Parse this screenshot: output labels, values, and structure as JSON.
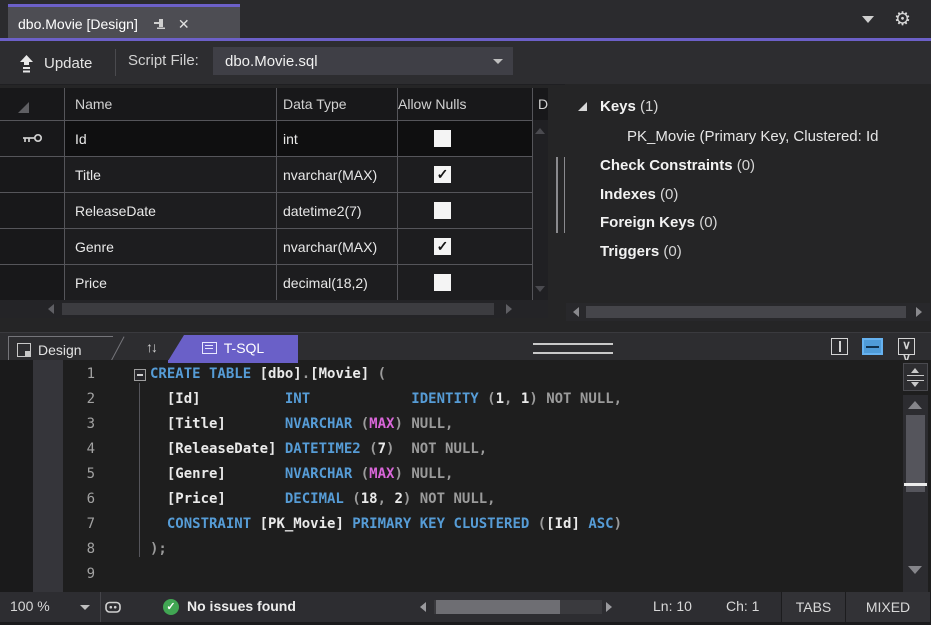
{
  "doc_tab": {
    "title": "dbo.Movie [Design]"
  },
  "toolbar": {
    "update_label": "Update",
    "script_file_label": "Script File:",
    "script_file_value": "dbo.Movie.sql"
  },
  "grid": {
    "columns": [
      "Name",
      "Data Type",
      "Allow Nulls",
      "D"
    ],
    "rows": [
      {
        "name": "Id",
        "data_type": "int",
        "allow_nulls": false,
        "is_key": true,
        "selected": true
      },
      {
        "name": "Title",
        "data_type": "nvarchar(MAX)",
        "allow_nulls": true,
        "is_key": false,
        "selected": false
      },
      {
        "name": "ReleaseDate",
        "data_type": "datetime2(7)",
        "allow_nulls": false,
        "is_key": false,
        "selected": false
      },
      {
        "name": "Genre",
        "data_type": "nvarchar(MAX)",
        "allow_nulls": true,
        "is_key": false,
        "selected": false
      },
      {
        "name": "Price",
        "data_type": "decimal(18,2)",
        "allow_nulls": false,
        "is_key": false,
        "selected": false
      }
    ]
  },
  "context_panel": {
    "rows": [
      {
        "type": "group",
        "label": "Keys",
        "count": "(1)",
        "expanded": true
      },
      {
        "type": "item",
        "name": "PK_Movie",
        "detail": "   (Primary Key, Clustered: Id"
      },
      {
        "type": "group",
        "label": "Check Constraints",
        "count": "(0)",
        "expanded": false
      },
      {
        "type": "group",
        "label": "Indexes",
        "count": "(0)",
        "expanded": false
      },
      {
        "type": "group",
        "label": "Foreign Keys",
        "count": "(0)",
        "expanded": false
      },
      {
        "type": "group",
        "label": "Triggers",
        "count": "(0)",
        "expanded": false
      }
    ]
  },
  "pane_tabs": {
    "design_label": "Design",
    "tsql_label": "T-SQL"
  },
  "editor": {
    "lines": [
      {
        "n": "1",
        "toks": [
          {
            "c": "k",
            "t": "CREATE TABLE"
          },
          {
            "c": "i",
            "t": " [dbo]"
          },
          {
            "c": "g",
            "t": "."
          },
          {
            "c": "i",
            "t": "[Movie]"
          },
          {
            "c": "g",
            "t": " ("
          }
        ]
      },
      {
        "n": "2",
        "toks": [
          {
            "c": "i",
            "t": "  [Id]          "
          },
          {
            "c": "k",
            "t": "INT            "
          },
          {
            "c": "k",
            "t": "IDENTITY"
          },
          {
            "c": "g",
            "t": " ("
          },
          {
            "c": "n",
            "t": "1"
          },
          {
            "c": "g",
            "t": ", "
          },
          {
            "c": "n",
            "t": "1"
          },
          {
            "c": "g",
            "t": ") "
          },
          {
            "c": "g",
            "t": "NOT NULL,"
          }
        ]
      },
      {
        "n": "3",
        "toks": [
          {
            "c": "i",
            "t": "  [Title]       "
          },
          {
            "c": "k",
            "t": "NVARCHAR"
          },
          {
            "c": "g",
            "t": " ("
          },
          {
            "c": "m",
            "t": "MAX"
          },
          {
            "c": "g",
            "t": ") "
          },
          {
            "c": "g",
            "t": "NULL,"
          }
        ]
      },
      {
        "n": "4",
        "toks": [
          {
            "c": "i",
            "t": "  [ReleaseDate] "
          },
          {
            "c": "k",
            "t": "DATETIME2"
          },
          {
            "c": "g",
            "t": " ("
          },
          {
            "c": "n",
            "t": "7"
          },
          {
            "c": "g",
            "t": ")  "
          },
          {
            "c": "g",
            "t": "NOT NULL,"
          }
        ]
      },
      {
        "n": "5",
        "toks": [
          {
            "c": "i",
            "t": "  [Genre]       "
          },
          {
            "c": "k",
            "t": "NVARCHAR"
          },
          {
            "c": "g",
            "t": " ("
          },
          {
            "c": "m",
            "t": "MAX"
          },
          {
            "c": "g",
            "t": ") "
          },
          {
            "c": "g",
            "t": "NULL,"
          }
        ]
      },
      {
        "n": "6",
        "toks": [
          {
            "c": "i",
            "t": "  [Price]       "
          },
          {
            "c": "k",
            "t": "DECIMAL"
          },
          {
            "c": "g",
            "t": " ("
          },
          {
            "c": "n",
            "t": "18"
          },
          {
            "c": "g",
            "t": ", "
          },
          {
            "c": "n",
            "t": "2"
          },
          {
            "c": "g",
            "t": ") "
          },
          {
            "c": "g",
            "t": "NOT NULL,"
          }
        ]
      },
      {
        "n": "7",
        "toks": [
          {
            "c": "k",
            "t": "  CONSTRAINT"
          },
          {
            "c": "i",
            "t": " [PK_Movie]"
          },
          {
            "c": "k",
            "t": " PRIMARY KEY CLUSTERED"
          },
          {
            "c": "g",
            "t": " ("
          },
          {
            "c": "i",
            "t": "[Id]"
          },
          {
            "c": "k",
            "t": " ASC"
          },
          {
            "c": "g",
            "t": ")"
          }
        ]
      },
      {
        "n": "8",
        "toks": [
          {
            "c": "g",
            "t": ");"
          }
        ]
      },
      {
        "n": "9",
        "toks": []
      }
    ]
  },
  "status_bar": {
    "zoom": "100 %",
    "message": "No issues found",
    "ln": "Ln: 10",
    "ch": "Ch: 1",
    "tabs": "TABS",
    "mixed": "MIXED"
  },
  "colors": {
    "accent_purple": "#6c60c8",
    "keyword_blue": "#569cd6",
    "type_magenta": "#d966d9",
    "status_green": "#41a653"
  }
}
